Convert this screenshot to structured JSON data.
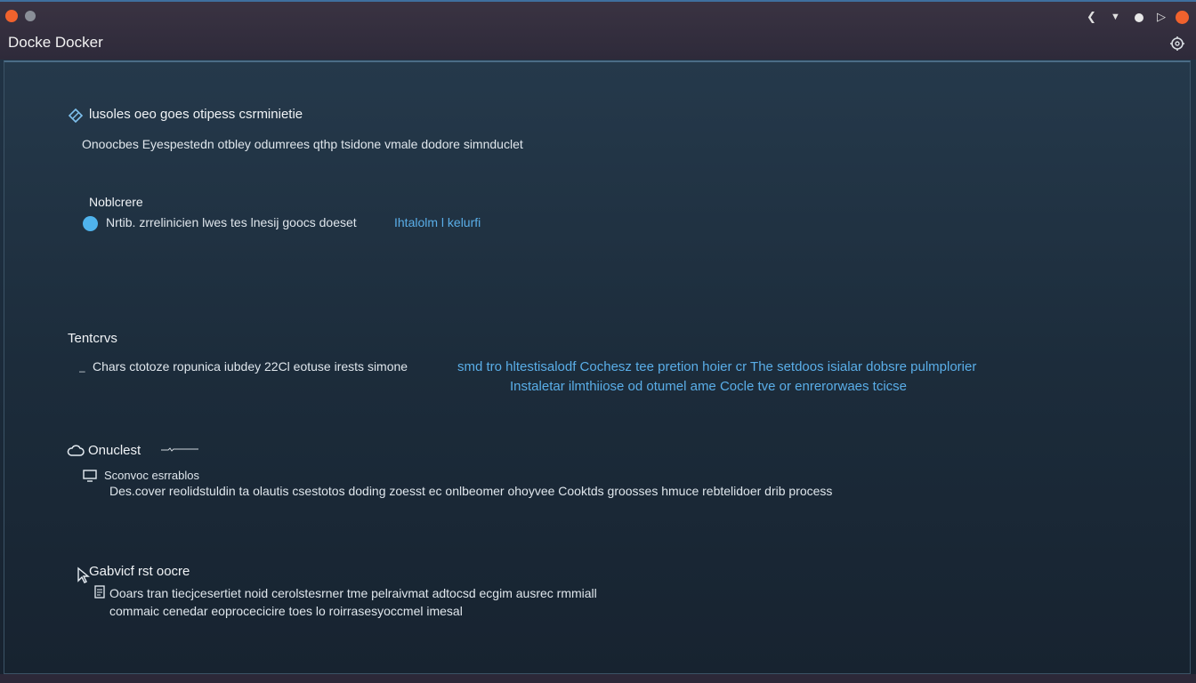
{
  "window": {
    "title": "Docke Docker",
    "controls": {
      "back_icon": "chevron-left-icon",
      "down_icon": "chevron-down-icon",
      "forward_icon": "play-icon",
      "gear_icon": "gear-icon"
    }
  },
  "sections": {
    "intro": {
      "heading": "lusoles oeo goes otipess csrminietie",
      "description": "Onoocbes Eyespestedn otbley odumrees qthp tsidone vmale dodore simnduclet"
    },
    "note": {
      "heading": "Noblcrere",
      "item_text": "Nrtib. zrrelinicien lwes tes lnesij goocs doeset",
      "item_link": "Ihtalolm l kelurfi"
    },
    "tenters": {
      "heading": "Tentcrvs",
      "item_text": "Chars ctotoze ropunica iubdey 22Cl eotuse irests simone",
      "item_link_line1": "smd tro hltestisalodf Cochesz tee pretion hoier cr The setdoos isialar dobsre pulmplorier",
      "item_link_line2": "Instaletar ilmthiiose od otumel ame Cocle tve or enrerorwaes tcicse"
    },
    "ondclest": {
      "heading": "Onuclest",
      "subitem_label": "Sconvoc esrrablos",
      "subitem_text": "Des.cover reolidstuldin ta olautis csestotos doding zoesst ec onlbeomer ohoyvee Cooktds groosses hmuce rebtelidoer drib process"
    },
    "gabvict": {
      "heading": "Gabvicf rst oocre",
      "line1": "Ooars tran tiecjcesertiet noid cerolstesrner tme pelraivmat adtocsd ecgim ausrec rmmiall",
      "line2": "commaic cenedar eoprocecicire toes lo roirrasesyoccmel imesal"
    }
  },
  "colors": {
    "accent_blue": "#5aaee8",
    "close_orange": "#f0622d",
    "titlebar": "#2e2a3a",
    "content_bg": "#1c2c3b"
  }
}
